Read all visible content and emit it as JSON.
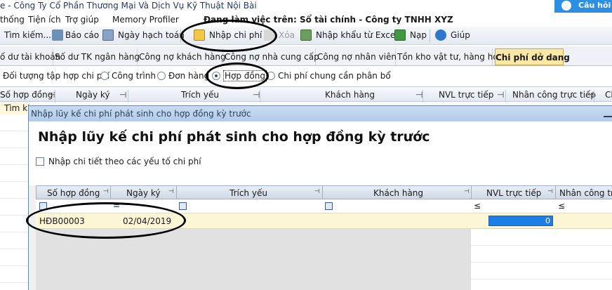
{
  "window": {
    "title": "e - Công Ty Cổ Phần Thương Mại Và Dịch Vụ Kỹ Thuật Nội Bài",
    "help_label": "Câu hỏi t"
  },
  "menu": {
    "items": [
      "thống",
      "Tiện ích",
      "Trợ giúp",
      "Memory Profiler"
    ],
    "workspace": "Đang làm việc trên: Sổ tài chính - Công ty TNHH XYZ"
  },
  "toolbar": {
    "search": "Tìm kiếm...",
    "report": "Báo cáo",
    "posting_date": "Ngày hạch toán",
    "input_cost": "Nhập chi phí",
    "delete": "Xóa",
    "import_excel": "Nhập khẩu từ Excel",
    "load": "Nạp",
    "help": "Giúp"
  },
  "tabs": [
    {
      "label": "ố dư tài khoản"
    },
    {
      "label": "Số dư TK ngân hàng"
    },
    {
      "label": "Công nợ khách hàng"
    },
    {
      "label": "Công nợ nhà cung cấp"
    },
    {
      "label": "Công nợ nhân viên"
    },
    {
      "label": "Tồn kho vật tư, hàng hóa"
    },
    {
      "label": "Chi phí dở dang",
      "active": true
    }
  ],
  "cost_object": {
    "label": "Đối tượng tập hợp chi phí",
    "options": [
      "Công trình",
      "Đơn hàng",
      "Hợp đồng",
      "Chi phí chung cần phân bổ"
    ],
    "selected": "Hợp đồng"
  },
  "bg_grid": {
    "columns": [
      "Số hợp đồng",
      "Ngày ký",
      "Trích yếu",
      "Khách hàng",
      "NVL trực tiếp",
      "Nhân công trực tiếp",
      "Cl"
    ],
    "search_stub": "Tìm ki"
  },
  "dialog": {
    "title": "Nhập lũy kế chi phí phát sinh cho hợp đồng kỳ trước",
    "heading": "Nhập lũy kế chi phí phát sinh cho hợp đồng kỳ trước",
    "detail_checkbox": "Nhập chi tiết theo các yếu tố chi phí",
    "detail_checked": false,
    "columns": [
      "Số hợp đồng",
      "Ngày ký",
      "Trích yếu",
      "Khách hàng",
      "NVL trực tiếp",
      "Nhân công trực"
    ],
    "filter_ops": [
      "=",
      "≤",
      "≤"
    ],
    "rows": [
      {
        "contract_no": "HĐB00003",
        "sign_date": "02/04/2019",
        "summary": "",
        "customer": "",
        "materials": "0"
      }
    ]
  },
  "colors": {
    "active_tab": "#fbe7a6",
    "dialog_title": "#b3cbe9",
    "selected_cell": "#1e7ee8",
    "row_highlight": "#fdf6d4"
  }
}
